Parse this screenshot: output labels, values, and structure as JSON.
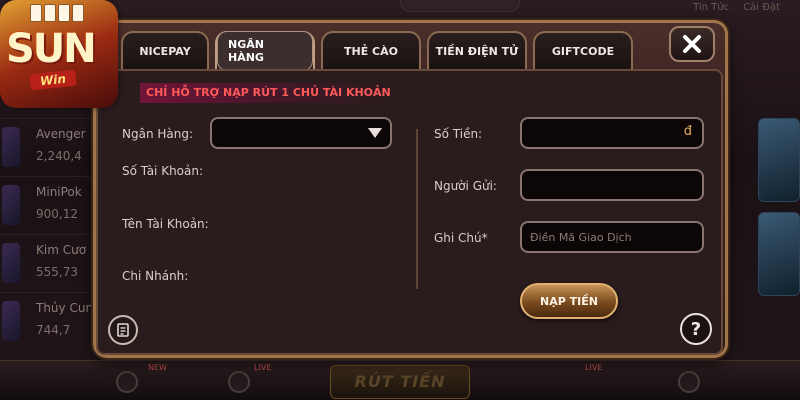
{
  "background": {
    "top_tabs": [
      "Tin Tức",
      "Cài Đặt"
    ],
    "lobby": [
      {
        "name": "Avenger",
        "amount": "2,240,4"
      },
      {
        "name": "MiniPok",
        "amount": "900,12"
      },
      {
        "name": "Kim Cươ",
        "amount": "555,73"
      },
      {
        "name": "Thủy Cun",
        "amount": "744,7"
      }
    ],
    "bottom_center": "RÚT TIỀN",
    "badges": {
      "new": "NEW",
      "live1": "LIVE",
      "live2": "LIVE"
    }
  },
  "logo": {
    "word": "SUN",
    "sub": "Win"
  },
  "modal": {
    "tabs": [
      {
        "label": "NICEPAY",
        "active": false
      },
      {
        "label": "NGÂN HÀNG",
        "active": true
      },
      {
        "label": "THẺ CÀO",
        "active": false
      },
      {
        "label": "TIỀN ĐIỆN TỬ",
        "active": false
      },
      {
        "label": "GIFTCODE",
        "active": false
      }
    ],
    "notice": "CHỈ HỖ TRỢ NẠP RÚT 1 CHỦ TÀI KHOẢN",
    "left": {
      "bank_label": "Ngân Hàng:",
      "bank_value": "",
      "account_number_label": "Số Tài Khoản:",
      "account_name_label": "Tên Tài Khoản:",
      "branch_label": "Chi Nhánh:"
    },
    "right": {
      "amount_label": "Số Tiền:",
      "amount_value": "",
      "currency_symbol": "đ",
      "sender_label": "Người Gửi:",
      "sender_value": "",
      "note_label": "Ghi Chú*",
      "note_placeholder": "Điền Mã Giao Dịch"
    },
    "submit_label": "NẠP TIỀN",
    "help_label": "?"
  },
  "colors": {
    "notice_text": "#ff5a5a",
    "frame_gold": "#a1744a",
    "button_gold": "#c89258"
  },
  "icons": {
    "close": "close-icon",
    "dropdown": "chevron-down-icon",
    "history": "document-icon",
    "help": "help-icon"
  }
}
